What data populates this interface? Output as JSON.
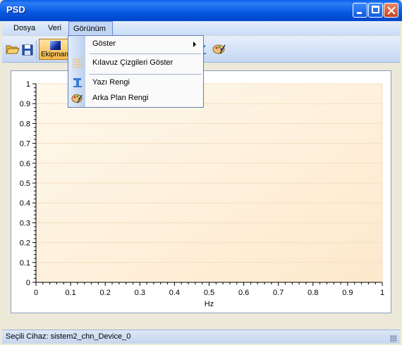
{
  "window": {
    "title": "PSD"
  },
  "menu": {
    "items": [
      "Dosya",
      "Veri",
      "Görünüm"
    ],
    "active": "Görünüm"
  },
  "toolbar": {
    "equipment_label": "Ekipman"
  },
  "dropdown": {
    "items": [
      {
        "label": "Göster",
        "icon": "show-icon",
        "submenu": true
      },
      {
        "label": "Kılavuz Çizgileri Göster",
        "icon": "grid-icon",
        "submenu": false
      },
      {
        "label": "Yazı Rengi",
        "icon": "text-color-icon",
        "submenu": false
      },
      {
        "label": "Arka Plan Rengi",
        "icon": "palette-icon",
        "submenu": false
      }
    ]
  },
  "chart_data": {
    "type": "line",
    "xlabel": "Hz",
    "ylabel": "",
    "xlim": [
      0,
      1
    ],
    "ylim": [
      0,
      1
    ],
    "x_ticks": [
      "0",
      "0.1",
      "0.2",
      "0.3",
      "0.4",
      "0.5",
      "0.6",
      "0.7",
      "0.8",
      "0.9",
      "1"
    ],
    "y_ticks": [
      "0",
      "0.1",
      "0.2",
      "0.3",
      "0.4",
      "0.5",
      "0.6",
      "0.7",
      "0.8",
      "0.9",
      "1"
    ],
    "series": [],
    "grid": true,
    "plot_bg_top": "#FFF8EC",
    "plot_bg_bottom": "#FDE9CC"
  },
  "status": {
    "text": "Seçili Cihaz: sistem2_chn_Device_0"
  },
  "colors": {
    "titlebar": "#0A5FE8",
    "menu_highlight": "#C1D6F5",
    "toolbar_selected": "#F6B94C"
  }
}
